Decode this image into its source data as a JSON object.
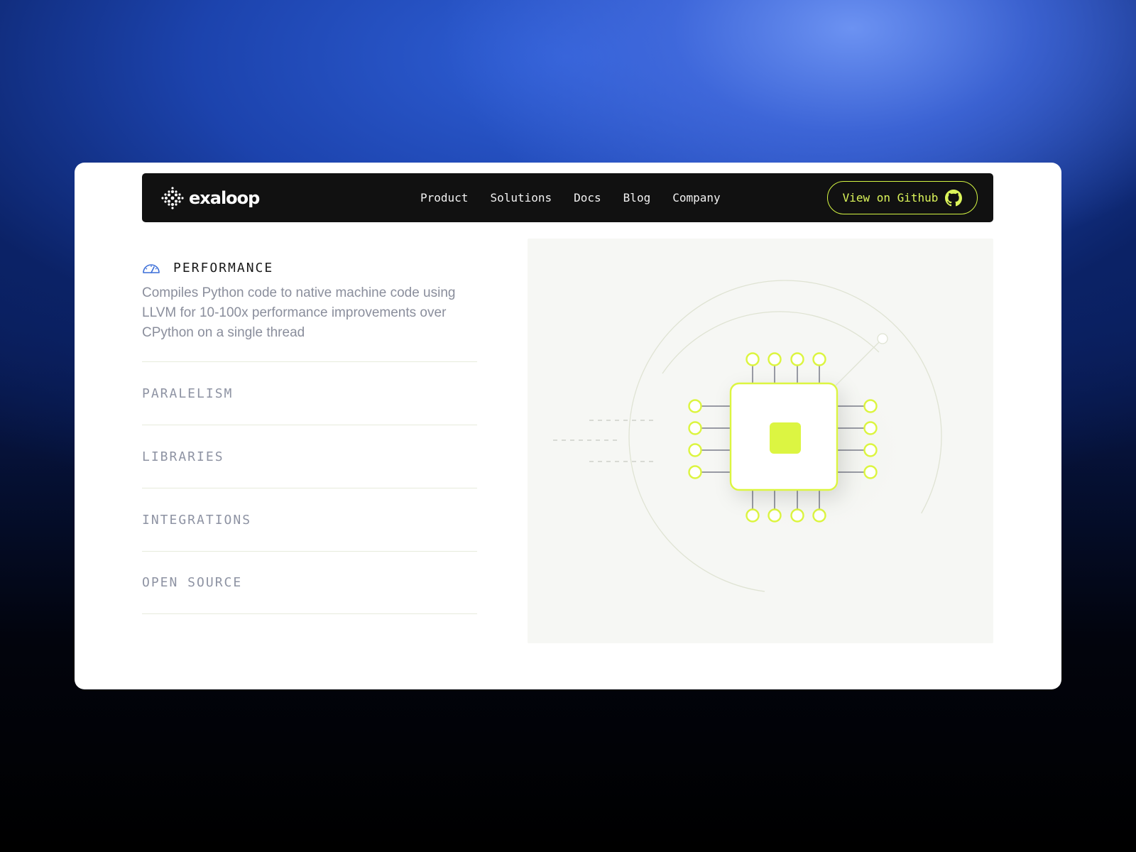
{
  "brand": {
    "name": "exaloop"
  },
  "nav": {
    "links": [
      "Product",
      "Solutions",
      "Docs",
      "Blog",
      "Company"
    ],
    "cta_label": "View on Github"
  },
  "features": {
    "active": {
      "title": "PERFORMANCE",
      "description": "Compiles Python code to native machine code using LLVM for 10-100x performance improvements over CPython on a single thread",
      "icon": "gauge-icon"
    },
    "items": [
      "PARALELISM",
      "LIBRARIES",
      "INTEGRATIONS",
      "OPEN SOURCE"
    ]
  },
  "colors": {
    "accent": "#d9f542",
    "navbar_bg": "#111111",
    "card_bg": "#ffffff",
    "illustration_bg": "#f6f7f4"
  }
}
